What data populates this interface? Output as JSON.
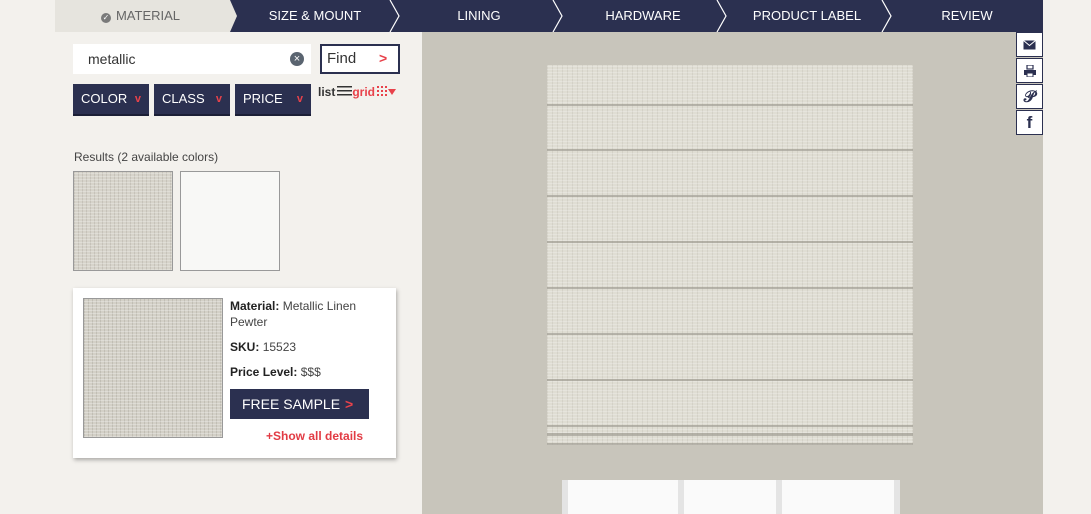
{
  "steps": [
    {
      "label": "MATERIAL",
      "active": true
    },
    {
      "label": "SIZE & MOUNT",
      "active": false
    },
    {
      "label": "LINING",
      "active": false
    },
    {
      "label": "HARDWARE",
      "active": false
    },
    {
      "label": "PRODUCT LABEL",
      "active": false
    },
    {
      "label": "REVIEW",
      "active": false
    }
  ],
  "search": {
    "value": "metallic",
    "find_label": "Find",
    "find_arrow": ">"
  },
  "filters": [
    {
      "label": "COLOR",
      "arrow": "v"
    },
    {
      "label": "CLASS",
      "arrow": "v"
    },
    {
      "label": "PRICE",
      "arrow": "v"
    }
  ],
  "view": {
    "list": "list",
    "grid": "grid"
  },
  "results": {
    "label": "Results (2 available colors)"
  },
  "product": {
    "material_label": "Material:",
    "material_value": "Metallic Linen Pewter",
    "sku_label": "SKU:",
    "sku_value": "15523",
    "price_label": "Price Level:",
    "price_value": "$$$",
    "sample_button": "FREE SAMPLE",
    "sample_arrow": ">",
    "details_link": "+Show all details"
  },
  "share_icons": [
    "email-icon",
    "print-icon",
    "pinterest-icon",
    "facebook-icon"
  ],
  "colors": {
    "navy": "#2b3050",
    "accent": "#e8424b",
    "panel": "#f3f1ed",
    "shade": "#dfddd3"
  }
}
